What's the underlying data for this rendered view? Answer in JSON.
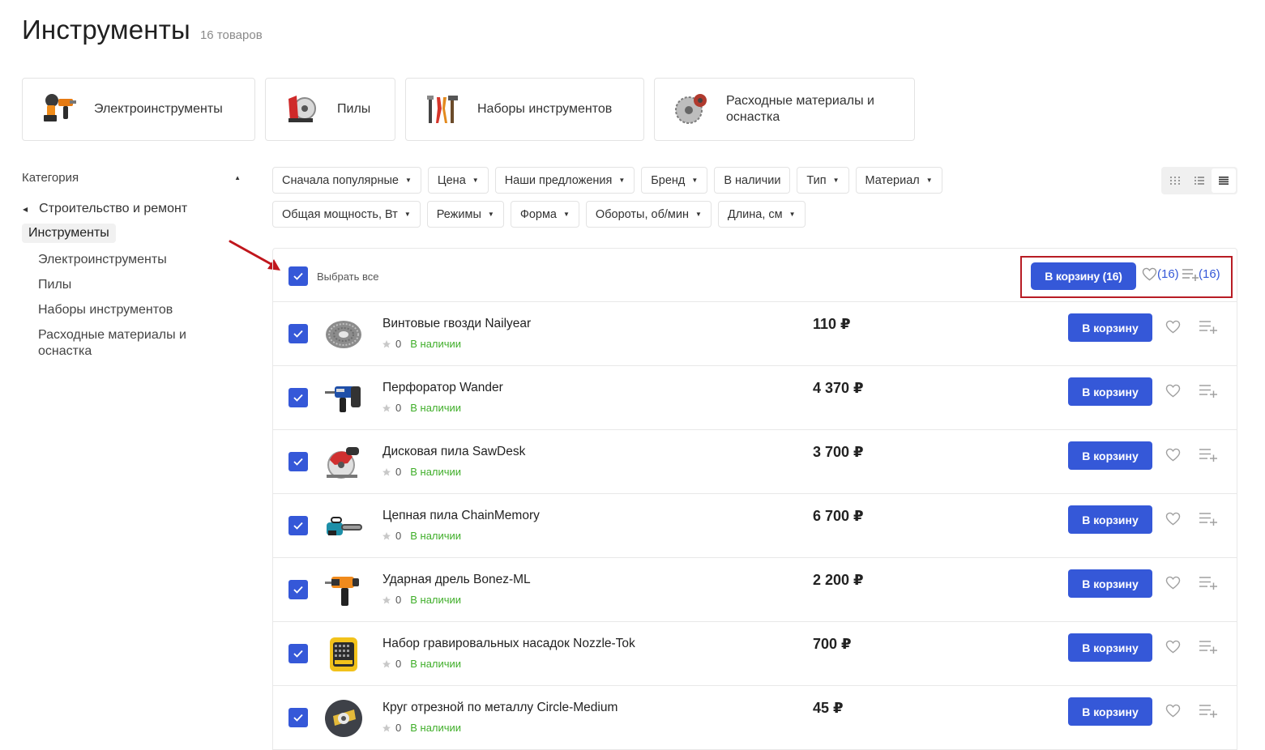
{
  "page": {
    "title": "Инструменты",
    "count": "16 товаров"
  },
  "category_cards": [
    {
      "label": "Электроинструменты",
      "icon": "power-tools-icon"
    },
    {
      "label": "Пилы",
      "icon": "saw-icon"
    },
    {
      "label": "Наборы инструментов",
      "icon": "tool-set-icon"
    },
    {
      "label_line1": "Расходные материалы и",
      "label_line2": "оснастка",
      "icon": "saw-blade-icon"
    }
  ],
  "sidebar": {
    "heading": "Категория",
    "parent": "Строительство и ремонт",
    "current": "Инструменты",
    "children": [
      "Электроинструменты",
      "Пилы",
      "Наборы инструментов"
    ],
    "last_child_line1": "Расходные материалы и",
    "last_child_line2": "оснастка"
  },
  "filters": [
    "Сначала популярные",
    "Цена",
    "Наши предложения",
    "Бренд",
    "В наличии",
    "Тип",
    "Материал",
    "Общая мощность, Вт",
    "Режимы",
    "Форма",
    "Обороты, об/мин",
    "Длина, см"
  ],
  "filters_without_caret": [
    "В наличии"
  ],
  "view_modes": [
    "grid-view-icon",
    "list-view-icon",
    "compact-list-view-icon"
  ],
  "active_view": "compact-list-view-icon",
  "bulk": {
    "select_all_label": "Выбрать все",
    "select_all_checked": true,
    "cart_label": "В корзину",
    "cart_count": "(16)",
    "fav_count": "(16)",
    "compare_count": "(16)"
  },
  "products": [
    {
      "name": "Винтовые гвозди Nailyear",
      "rating": "0",
      "stock": "В наличии",
      "price": "110 ₽",
      "cart_label": "В корзину",
      "checked": true,
      "icon": "coil-nails-icon"
    },
    {
      "name": "Перфоратор Wander",
      "rating": "0",
      "stock": "В наличии",
      "price": "4 370 ₽",
      "cart_label": "В корзину",
      "checked": true,
      "icon": "rotary-hammer-icon"
    },
    {
      "name": "Дисковая пила SawDesk",
      "rating": "0",
      "stock": "В наличии",
      "price": "3 700 ₽",
      "cart_label": "В корзину",
      "checked": true,
      "icon": "circular-saw-icon"
    },
    {
      "name": "Цепная пила ChainMemory",
      "rating": "0",
      "stock": "В наличии",
      "price": "6 700 ₽",
      "cart_label": "В корзину",
      "checked": true,
      "icon": "chainsaw-icon"
    },
    {
      "name": "Ударная дрель Bonez-ML",
      "rating": "0",
      "stock": "В наличии",
      "price": "2 200 ₽",
      "cart_label": "В корзину",
      "checked": true,
      "icon": "impact-drill-icon"
    },
    {
      "name": "Набор гравировальных насадок Nozzle-Tok",
      "rating": "0",
      "stock": "В наличии",
      "price": "700 ₽",
      "cart_label": "В корзину",
      "checked": true,
      "icon": "engraving-kit-icon"
    },
    {
      "name": "Круг отрезной по металлу Circle-Medium",
      "rating": "0",
      "stock": "В наличии",
      "price": "45 ₽",
      "cart_label": "В корзину",
      "checked": true,
      "icon": "cutting-disc-icon"
    }
  ],
  "colors": {
    "accent": "#3558d8",
    "stock": "#3fae29",
    "highlight": "#b81c24",
    "arrow": "#c0161c"
  }
}
